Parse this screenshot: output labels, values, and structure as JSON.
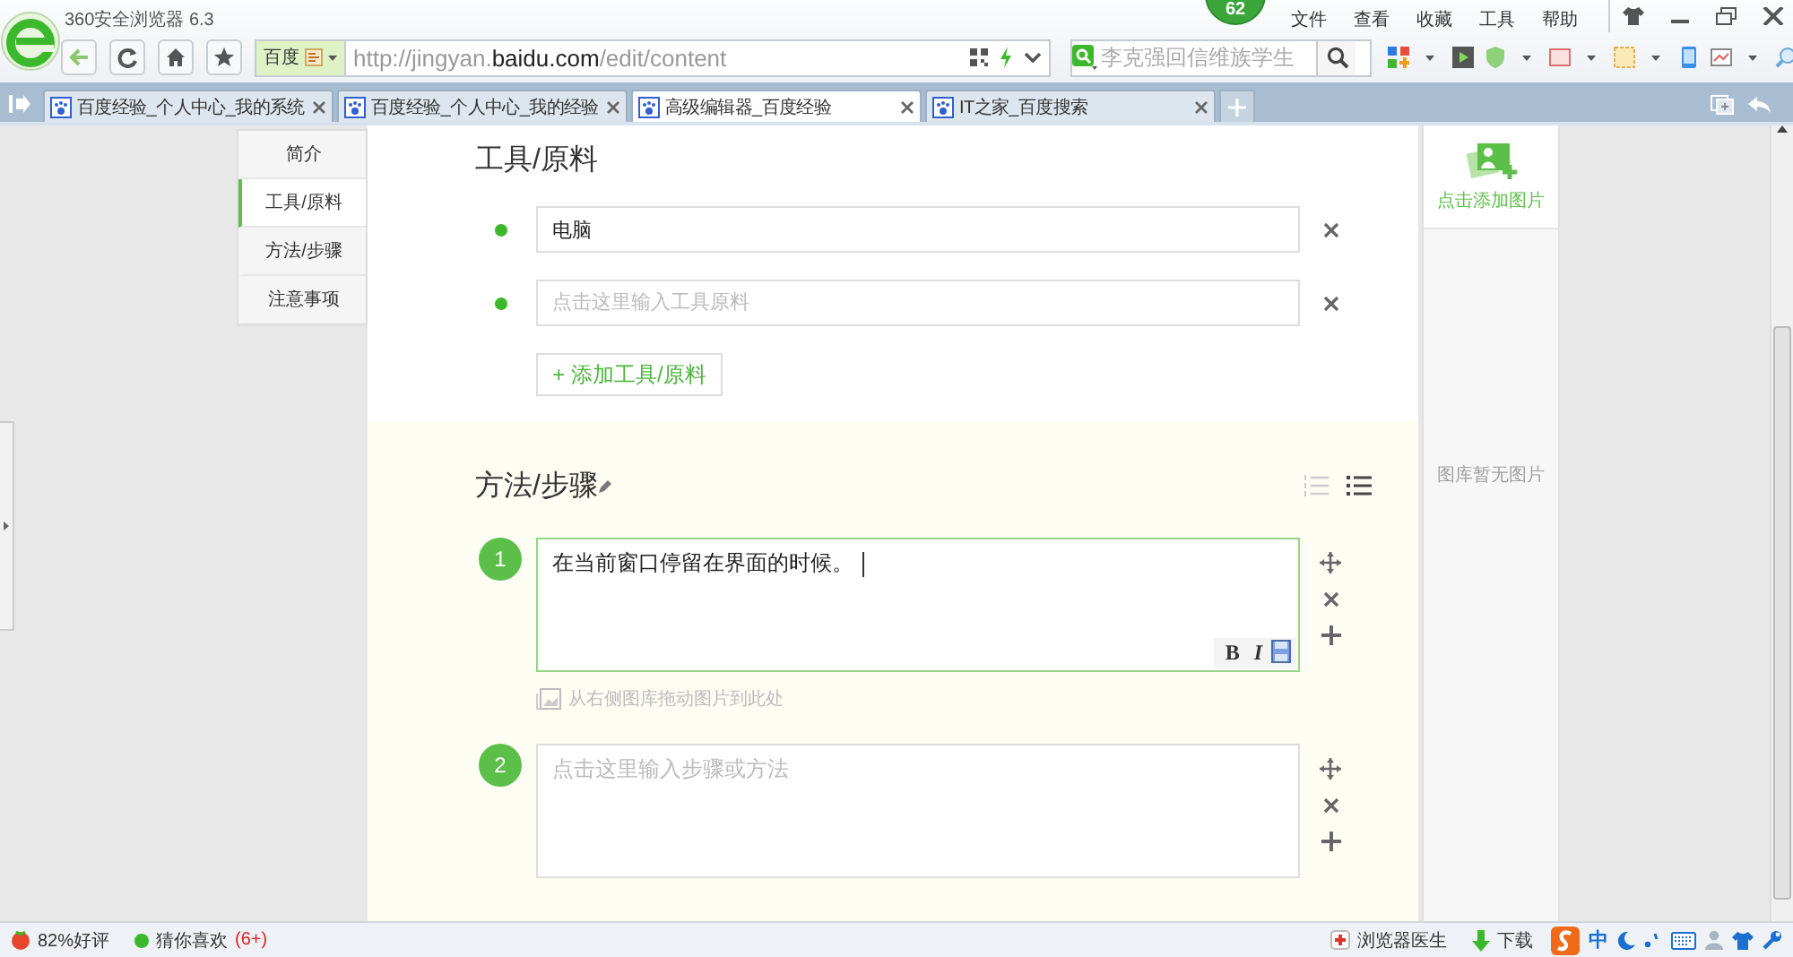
{
  "window": {
    "title": "360安全浏览器 6.3",
    "badge": "62",
    "menu": [
      "文件",
      "查看",
      "收藏",
      "工具",
      "帮助"
    ]
  },
  "toolbar": {
    "search_engine": "百度",
    "address": "http://jingyan.**baidu.com**/edit/content",
    "search": {
      "placeholder": "李克强回信维族学生"
    }
  },
  "tabs": [
    {
      "label": "百度经验_个人中心_我的系统",
      "selected": false
    },
    {
      "label": "百度经验_个人中心_我的经验",
      "selected": false
    },
    {
      "label": "高级编辑器_百度经验",
      "selected": true
    },
    {
      "label": "IT之家_百度搜索",
      "selected": false
    }
  ],
  "sidebar": {
    "items": [
      {
        "label": "简介",
        "selected": false
      },
      {
        "label": "工具/原料",
        "selected": true
      },
      {
        "label": "方法/步骤",
        "selected": false
      },
      {
        "label": "注意事项",
        "selected": false
      }
    ]
  },
  "tools": {
    "heading": "工具/原料",
    "items": [
      {
        "value": "电脑"
      },
      {
        "placeholder": "点击这里输入工具原料"
      }
    ],
    "add_button": "+ 添加工具/原料"
  },
  "steps": {
    "heading": "方法/步骤",
    "items": [
      {
        "number": "1",
        "value": "在当前窗口停留在界面的时候。",
        "focused": true,
        "format_buttons": [
          "B",
          "I"
        ],
        "image_hint": "从右侧图库拖动图片到此处"
      },
      {
        "number": "2",
        "placeholder": "点击这里输入步骤或方法",
        "focused": false
      }
    ]
  },
  "gallery": {
    "add_label": "点击添加图片",
    "empty_text": "图库暂无图片"
  },
  "status_bar": {
    "rating": "82%好评",
    "recommend": "猜你喜欢",
    "recommend_count": "(6+)",
    "doctor": "浏览器医生",
    "download": "下载",
    "ime": "中"
  }
}
